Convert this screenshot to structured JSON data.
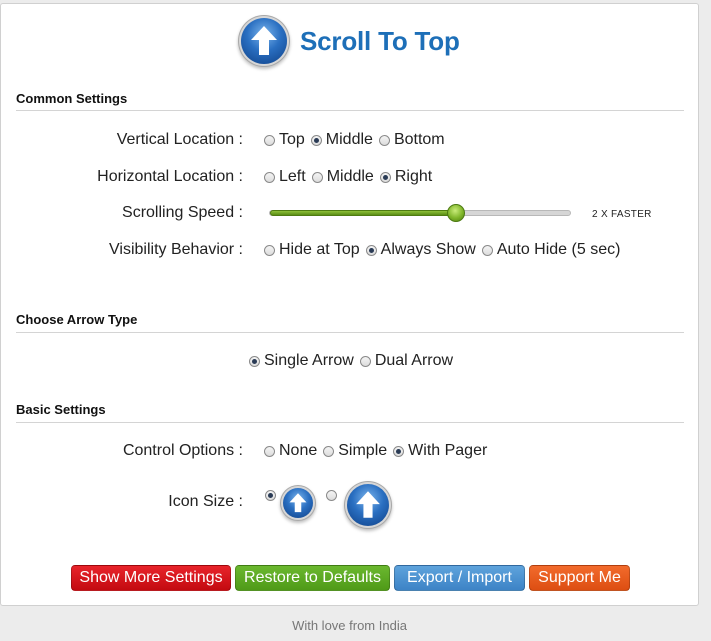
{
  "header": {
    "title": "Scroll To Top",
    "icon": "up-arrow-icon"
  },
  "sections": {
    "common": "Common Settings",
    "arrow_type": "Choose Arrow Type",
    "basic": "Basic Settings"
  },
  "vertical_location": {
    "label": "Vertical Location :",
    "options": [
      "Top",
      "Middle",
      "Bottom"
    ],
    "selected": "Middle"
  },
  "horizontal_location": {
    "label": "Horizontal Location :",
    "options": [
      "Left",
      "Middle",
      "Right"
    ],
    "selected": "Right"
  },
  "scrolling_speed": {
    "label": "Scrolling Speed :",
    "value_text": "2 X FASTER",
    "level": 0.62
  },
  "visibility": {
    "label": "Visibility Behavior :",
    "options": [
      "Hide at Top",
      "Always Show",
      "Auto Hide (5 sec)"
    ],
    "selected": "Always Show"
  },
  "arrow_type": {
    "options": [
      "Single Arrow",
      "Dual Arrow"
    ],
    "selected": "Single Arrow"
  },
  "control_options": {
    "label": "Control Options :",
    "options": [
      "None",
      "Simple",
      "With Pager"
    ],
    "selected": "With Pager"
  },
  "icon_size": {
    "label": "Icon Size :",
    "options": [
      "small-up-arrow-icon",
      "large-up-arrow-icon"
    ],
    "selected": "small-up-arrow-icon"
  },
  "buttons": {
    "show_more": "Show More Settings",
    "restore": "Restore to Defaults",
    "export_import": "Export / Import",
    "support": "Support Me"
  },
  "colors": {
    "title": "#1d6fb8",
    "red": "#d8151b",
    "green": "#5ea823",
    "blue": "#4d93d2",
    "orange": "#e85c1e",
    "slider_fill": "#6fa52a"
  },
  "footer": {
    "text": "With love from India"
  }
}
